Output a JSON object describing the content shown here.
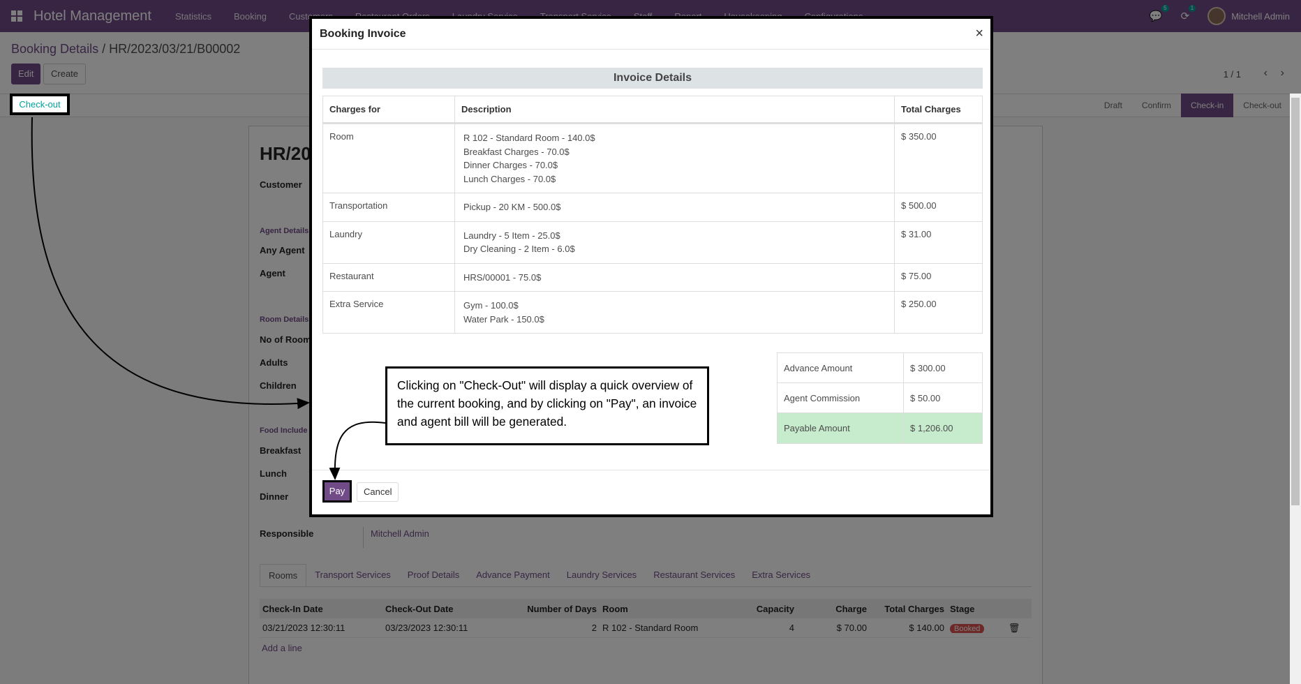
{
  "app": {
    "title": "Hotel Management",
    "menu": [
      "Statistics",
      "Booking",
      "Customers",
      "Restaurant Orders",
      "Laundry Service",
      "Transport Service",
      "Staff",
      "Report",
      "Housekeeping",
      "Configurations"
    ],
    "messages_count": "5",
    "activities_count": "1",
    "user": "Mitchell Admin"
  },
  "breadcrumb": {
    "parent": "Booking Details",
    "sep": " / ",
    "current": "HR/2023/03/21/B00002"
  },
  "buttons": {
    "edit": "Edit",
    "create": "Create",
    "checkout": "Check-out"
  },
  "pager": {
    "text": "1 / 1",
    "prev": "‹",
    "next": "›"
  },
  "stages": [
    "Draft",
    "Confirm",
    "Check-in",
    "Check-out"
  ],
  "form": {
    "title": "HR/20",
    "customer_label": "Customer",
    "agent_section": "Agent Details",
    "any_agent": "Any Agent",
    "agent": "Agent",
    "room_section": "Room Details",
    "no_rooms": "No of Room",
    "adults": "Adults",
    "children": "Children",
    "food_section": "Food Include",
    "breakfast": "Breakfast",
    "lunch": "Lunch",
    "dinner": "Dinner",
    "responsible_label": "Responsible",
    "responsible_value": "Mitchell Admin",
    "tabs": [
      "Rooms",
      "Transport Services",
      "Proof Details",
      "Advance Payment",
      "Laundry Services",
      "Restaurant Services",
      "Extra Services"
    ],
    "rooms_table": {
      "headers": [
        "Check-In Date",
        "Check-Out Date",
        "Number of Days",
        "Room",
        "Capacity",
        "Charge",
        "Total Charges",
        "Stage"
      ],
      "row": [
        "03/21/2023 12:30:11",
        "03/23/2023 12:30:11",
        "2",
        "R 102 - Standard Room",
        "4",
        "$ 70.00",
        "$ 140.00",
        "Booked"
      ],
      "add_line": "Add a line"
    }
  },
  "modal": {
    "title": "Booking Invoice",
    "close": "×",
    "section_title": "Invoice Details",
    "headers": {
      "charges_for": "Charges for",
      "description": "Description",
      "total": "Total Charges"
    },
    "rows": [
      {
        "name": "Room",
        "desc": [
          "R 102 - Standard Room - 140.0$",
          "Breakfast Charges - 70.0$",
          "Dinner Charges - 70.0$",
          "Lunch Charges - 70.0$"
        ],
        "total": "$ 350.00"
      },
      {
        "name": "Transportation",
        "desc": [
          "Pickup - 20 KM - 500.0$"
        ],
        "total": "$ 500.00"
      },
      {
        "name": "Laundry",
        "desc": [
          "Laundry - 5 Item - 25.0$",
          "Dry Cleaning - 2 Item - 6.0$"
        ],
        "total": "$ 31.00"
      },
      {
        "name": "Restaurant",
        "desc": [
          "HRS/00001 - 75.0$"
        ],
        "total": "$ 75.00"
      },
      {
        "name": "Extra Service",
        "desc": [
          "Gym - 100.0$",
          "Water Park - 150.0$"
        ],
        "total": "$ 250.00"
      }
    ],
    "summary": [
      {
        "label": "Advance Amount",
        "value": "$ 300.00"
      },
      {
        "label": "Agent Commission",
        "value": "$ 50.00"
      },
      {
        "label": "Payable Amount",
        "value": "$ 1,206.00"
      }
    ],
    "pay": "Pay",
    "cancel": "Cancel"
  },
  "annotation": "Clicking on \"Check-Out\" will display a quick overview of the current booking, and by clicking on \"Pay\", an invoice and agent bill will be generated.",
  "colors": {
    "brand": "#714b87",
    "accent": "#00a09d",
    "payable_bg": "#c7ebcd",
    "booked": "#d9534f"
  }
}
